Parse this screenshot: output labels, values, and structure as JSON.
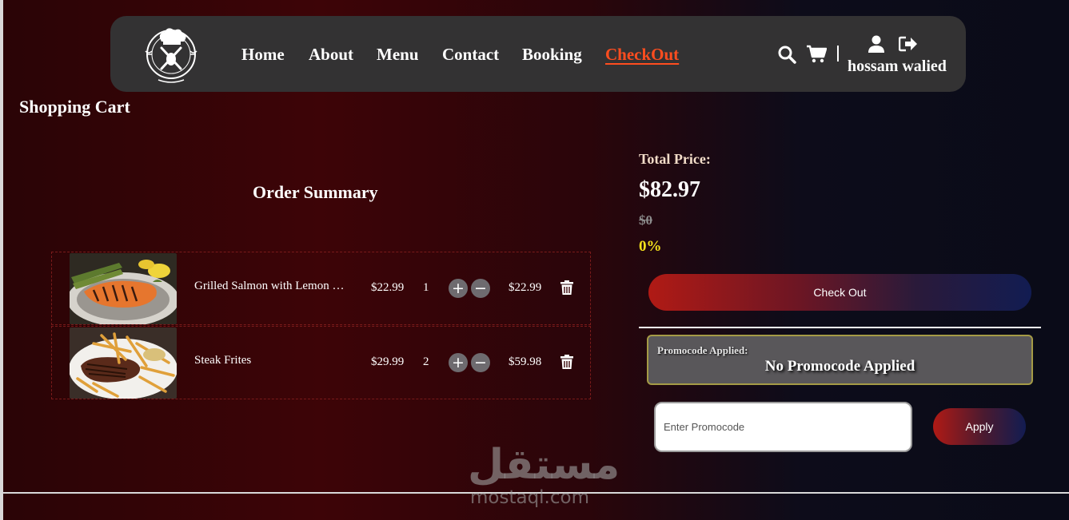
{
  "nav": {
    "links": [
      "Home",
      "About",
      "Menu",
      "Contact",
      "Booking",
      "CheckOut"
    ],
    "active": "CheckOut",
    "user_name": "hossam walied",
    "icons": [
      "search-icon",
      "cart-icon",
      "user-icon",
      "logout-icon"
    ]
  },
  "page": {
    "heading": "Shopping Cart",
    "summary_heading": "Order Summary"
  },
  "cart": {
    "items": [
      {
        "name": "Grilled Salmon with Lemon …",
        "price": "$22.99",
        "qty": "1",
        "total": "$22.99"
      },
      {
        "name": "Steak Frites",
        "price": "$29.99",
        "qty": "2",
        "total": "$59.98"
      }
    ],
    "plus_symbol": "+",
    "minus_symbol": "−"
  },
  "totals": {
    "label": "Total Price:",
    "value": "$82.97",
    "original": "$0",
    "discount": "0%"
  },
  "checkout": {
    "label": "Check Out"
  },
  "promo": {
    "label": "Promocode Applied:",
    "status": "No Promocode Applied",
    "placeholder": "Enter Promocode",
    "apply_label": "Apply"
  },
  "watermark": {
    "arabic": "مستقل",
    "latin": "mostaql.com"
  },
  "colors": {
    "accent": "#ff4d1f",
    "discount": "#f4e11c",
    "navbar": "#333233"
  }
}
